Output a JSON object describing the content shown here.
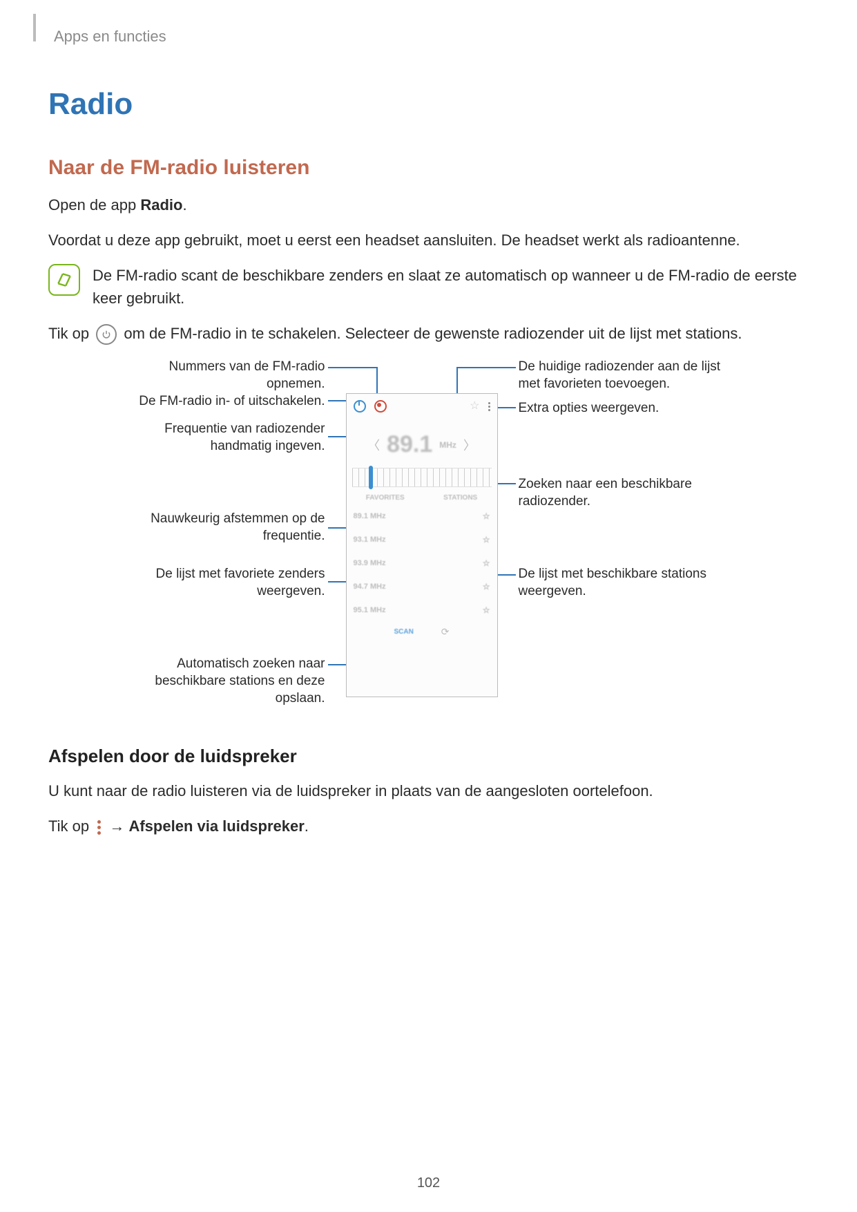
{
  "header": {
    "breadcrumb": "Apps en functies"
  },
  "title": "Radio",
  "section1": {
    "heading": "Naar de FM-radio luisteren",
    "p1_a": "Open de app ",
    "p1_b": "Radio",
    "p1_c": ".",
    "p2": "Voordat u deze app gebruikt, moet u eerst een headset aansluiten. De headset werkt als radioantenne.",
    "note": "De FM-radio scant de beschikbare zenders en slaat ze automatisch op wanneer u de FM-radio de eerste keer gebruikt.",
    "p3_a": "Tik op ",
    "p3_b": " om de FM-radio in te schakelen. Selecteer de gewenste radiozender uit de lijst met stations."
  },
  "legends": {
    "l1": "Nummers van de FM-radio opnemen.",
    "l2": "De FM-radio in- of uitschakelen.",
    "l3": "Frequentie van radiozender handmatig ingeven.",
    "l4": "Nauwkeurig afstemmen op de frequentie.",
    "l5": "De lijst met favoriete zenders weergeven.",
    "l6": "Automatisch zoeken naar beschikbare stations en deze opslaan.",
    "r1": "De huidige radiozender aan de lijst met favorieten toevoegen.",
    "r2": "Extra opties weergeven.",
    "r3": "Zoeken naar een beschikbare radiozender.",
    "r4": "De lijst met beschikbare stations weergeven."
  },
  "phone": {
    "frequency": "89.1",
    "unit": "MHz",
    "tab_fav": "FAVORITES",
    "tab_st": "STATIONS",
    "rows": [
      "89.1 MHz",
      "93.1 MHz",
      "93.9 MHz",
      "94.7 MHz",
      "95.1 MHz"
    ],
    "scan": "SCAN"
  },
  "section2": {
    "heading": "Afspelen door de luidspreker",
    "p1": "U kunt naar de radio luisteren via de luidspreker in plaats van de aangesloten oortelefoon.",
    "p2_a": "Tik op ",
    "p2_b": " → ",
    "p2_c": "Afspelen via luidspreker",
    "p2_d": "."
  },
  "page_number": "102"
}
